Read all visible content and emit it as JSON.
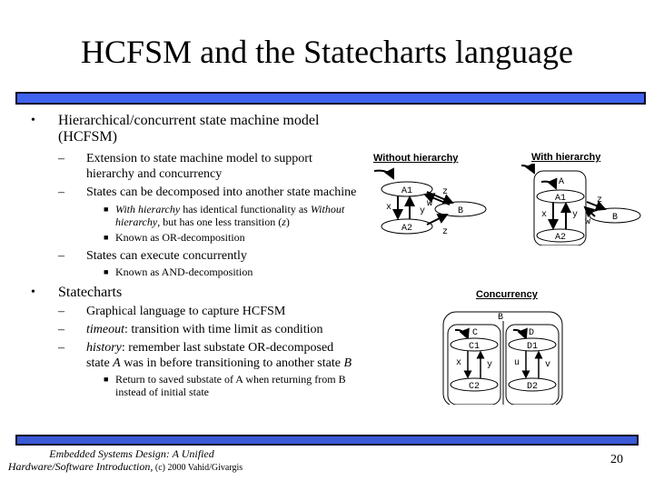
{
  "slide": {
    "title": "HCFSM and the Statecharts language",
    "page_number": "20",
    "footer": {
      "line1": "Embedded Systems Design: A Unified",
      "line2_italic": "Hardware/Software Introduction,",
      "line2_normal": " (c) 2000 Vahid/Givargis"
    },
    "colors": {
      "bar": "#3f63ef",
      "bar_border": "#0a0a2a"
    }
  },
  "bullets": [
    {
      "text_line1": "Hierarchical/concurrent state machine model",
      "text_line2": "(HCFSM)",
      "sub": [
        {
          "line1": "Extension to state machine model to support",
          "line2": "hierarchy and concurrency"
        },
        {
          "line1": "States can be decomposed into another state machine",
          "sub": [
            {
              "italic1": "With hierarchy",
              "text1": " has identical functionality as ",
              "italic2": "Without",
              "italic3": "hierarchy",
              "text2": ", but has one less transition (",
              "italic4": "z",
              "text3": ")"
            },
            {
              "text": "Known as OR-decomposition"
            }
          ]
        },
        {
          "line1": "States can execute concurrently",
          "sub": [
            {
              "text": "Known as AND-decomposition"
            }
          ]
        }
      ]
    },
    {
      "text_line1": "Statecharts",
      "sub": [
        {
          "line1": "Graphical language to capture HCFSM"
        },
        {
          "italic": "timeout",
          "rest": ": transition with time limit as condition"
        },
        {
          "italic": "history",
          "rest": ": remember last substate OR-decomposed",
          "line2a": "state ",
          "line2b": "A",
          "line2c": " was in before transitioning to another state ",
          "line2d": "B",
          "sub": [
            {
              "line1": "Return to saved substate of A when returning from B",
              "line2": "instead of initial state"
            }
          ]
        }
      ]
    }
  ],
  "diagrams": {
    "without_hierarchy": {
      "label": "Without hierarchy",
      "states": [
        "A1",
        "A2",
        "B"
      ],
      "transitions": [
        "x",
        "y",
        "z",
        "w",
        "z"
      ]
    },
    "with_hierarchy": {
      "label": "With hierarchy",
      "superstate": "A",
      "states": [
        "A1",
        "A2",
        "B"
      ],
      "transitions": [
        "x",
        "y",
        "z",
        "w"
      ]
    },
    "concurrency": {
      "label": "Concurrency",
      "superstate": "B",
      "regions": [
        {
          "name": "C",
          "states": [
            "C1",
            "C2"
          ],
          "transitions": [
            "x",
            "y"
          ]
        },
        {
          "name": "D",
          "states": [
            "D1",
            "D2"
          ],
          "transitions": [
            "u",
            "v"
          ]
        }
      ]
    }
  }
}
